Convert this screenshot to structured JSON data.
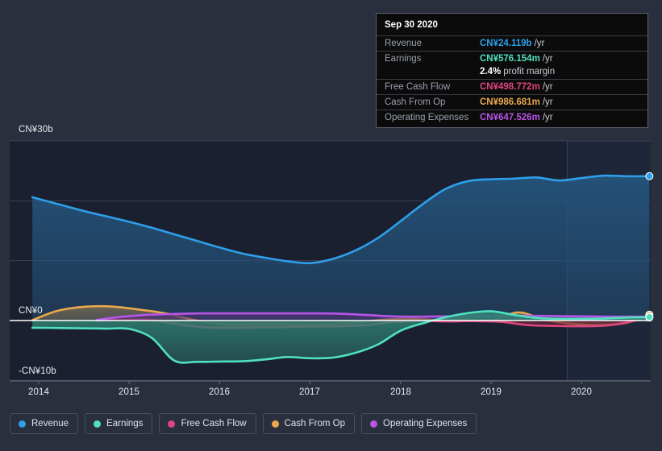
{
  "chart_data": {
    "type": "area",
    "title": "",
    "xlabel": "",
    "ylabel": "",
    "currency": "CN¥",
    "grid": true,
    "legend_position": "bottom",
    "xlim": [
      2013.57,
      2020.78
    ],
    "ylim": [
      -11.5,
      31.8
    ],
    "x_ticks": [
      "2014",
      "2015",
      "2016",
      "2017",
      "2018",
      "2019",
      "2020"
    ],
    "x_tick_values": [
      2014,
      2015,
      2016,
      2017,
      2018,
      2019,
      2020
    ],
    "y_ticks": [
      "CN¥30b",
      "CN¥0",
      "-CN¥10b"
    ],
    "y_tick_values": [
      30,
      0,
      -10
    ],
    "y_gridline_values": [
      30,
      20,
      10,
      0,
      -10
    ],
    "zero_line_value": 0,
    "forecast_start": 2019.84,
    "units": "billions CN¥ per year",
    "series": [
      {
        "name": "Revenue",
        "color": "#2e9fea",
        "fill": "#24547c",
        "x": [
          2013.93,
          2014.25,
          2014.5,
          2014.75,
          2015.0,
          2015.25,
          2015.5,
          2015.75,
          2016.0,
          2016.25,
          2016.5,
          2016.75,
          2017.0,
          2017.25,
          2017.5,
          2017.75,
          2018.0,
          2018.25,
          2018.5,
          2018.75,
          2019.0,
          2019.25,
          2019.5,
          2019.75,
          2020.0,
          2020.25,
          2020.5,
          2020.75
        ],
        "values": [
          20.6,
          19.3,
          18.3,
          17.4,
          16.5,
          15.5,
          14.4,
          13.3,
          12.2,
          11.2,
          10.5,
          9.9,
          9.6,
          10.3,
          11.7,
          13.8,
          16.6,
          19.5,
          22.0,
          23.3,
          23.6,
          23.7,
          23.9,
          23.4,
          23.8,
          24.2,
          24.1,
          24.119
        ]
      },
      {
        "name": "Earnings",
        "color": "#4fe0c0",
        "fill": "#2f7f71",
        "x": [
          2013.93,
          2014.25,
          2014.5,
          2014.75,
          2015.0,
          2015.25,
          2015.5,
          2015.75,
          2016.0,
          2016.25,
          2016.5,
          2016.75,
          2017.0,
          2017.25,
          2017.5,
          2017.75,
          2018.0,
          2018.25,
          2018.5,
          2018.75,
          2019.0,
          2019.25,
          2019.5,
          2019.75,
          2020.0,
          2020.25,
          2020.5,
          2020.75
        ],
        "values": [
          -1.2,
          -1.25,
          -1.3,
          -1.35,
          -1.4,
          -2.9,
          -6.7,
          -6.9,
          -6.85,
          -6.8,
          -6.5,
          -6.1,
          -6.3,
          -6.2,
          -5.4,
          -4.0,
          -1.7,
          -0.45,
          0.55,
          1.25,
          1.55,
          0.95,
          0.45,
          0.3,
          0.3,
          0.35,
          0.5,
          0.576
        ]
      },
      {
        "name": "Free Cash Flow",
        "color": "#e0447e",
        "fill": "#6b2438",
        "x": [
          2014.64,
          2014.9,
          2015.2,
          2015.5,
          2015.8,
          2016.1,
          2016.4,
          2016.7,
          2017.0,
          2017.3,
          2017.6,
          2017.9,
          2018.2,
          2018.5,
          2018.8,
          2019.1,
          2019.4,
          2019.7,
          2020.0,
          2020.3,
          2020.55,
          2020.75
        ],
        "values": [
          -0.1,
          0.1,
          0.15,
          -0.5,
          -1.1,
          -1.2,
          -1.15,
          -1.1,
          -1.0,
          -0.95,
          -0.8,
          -0.3,
          -0.05,
          -0.15,
          -0.1,
          -0.2,
          -0.75,
          -0.9,
          -0.95,
          -0.8,
          -0.15,
          0.4988
        ]
      },
      {
        "name": "Cash From Op",
        "color": "#eaa84e",
        "fill": "#6e6550",
        "x": [
          2013.93,
          2014.2,
          2014.5,
          2014.8,
          2015.1,
          2015.4,
          2015.7,
          2016.0,
          2016.3,
          2016.6,
          2016.9,
          2017.2,
          2017.5,
          2017.8,
          2018.1,
          2018.4,
          2018.7,
          2019.0,
          2019.3,
          2019.6,
          2019.9,
          2020.2,
          2020.5,
          2020.75
        ],
        "values": [
          0.05,
          1.6,
          2.3,
          2.35,
          1.85,
          1.2,
          0.15,
          -0.6,
          -0.7,
          -0.6,
          -0.75,
          -0.6,
          -0.35,
          0.15,
          0.3,
          0.1,
          0.25,
          0.0,
          1.35,
          0.1,
          -0.55,
          -0.75,
          -0.35,
          0.9867
        ]
      },
      {
        "name": "Operating Expenses",
        "color": "#b855e8",
        "fill": "#4b3272",
        "x": [
          2014.64,
          2014.9,
          2015.2,
          2015.5,
          2015.8,
          2016.1,
          2016.4,
          2016.7,
          2017.0,
          2017.3,
          2017.6,
          2017.9,
          2018.2,
          2018.5,
          2018.8,
          2019.1,
          2019.4,
          2019.7,
          2020.0,
          2020.3,
          2020.55,
          2020.75
        ],
        "values": [
          0.1,
          0.6,
          0.95,
          1.1,
          1.2,
          1.2,
          1.2,
          1.2,
          1.2,
          1.15,
          0.95,
          0.7,
          0.65,
          0.7,
          0.75,
          0.8,
          0.8,
          0.75,
          0.7,
          0.65,
          0.65,
          0.6475
        ]
      }
    ]
  },
  "tooltip": {
    "date": "Sep 30 2020",
    "rows": [
      {
        "key": "Revenue",
        "value": "CN¥24.119b",
        "suffix": "/yr",
        "color": "#2e9fea"
      },
      {
        "key": "Earnings",
        "value": "CN¥576.154m",
        "suffix": "/yr",
        "color": "#4fe0c0"
      },
      {
        "key": "",
        "value": "2.4%",
        "suffix": "profit margin",
        "color": "#ffffff"
      },
      {
        "key": "Free Cash Flow",
        "value": "CN¥498.772m",
        "suffix": "/yr",
        "color": "#e0447e"
      },
      {
        "key": "Cash From Op",
        "value": "CN¥986.681m",
        "suffix": "/yr",
        "color": "#eaa84e"
      },
      {
        "key": "Operating Expenses",
        "value": "CN¥647.526m",
        "suffix": "/yr",
        "color": "#b855e8"
      }
    ]
  },
  "legend": {
    "items": [
      {
        "label": "Revenue",
        "color": "#2e9fea"
      },
      {
        "label": "Earnings",
        "color": "#4fe0c0"
      },
      {
        "label": "Free Cash Flow",
        "color": "#e0447e"
      },
      {
        "label": "Cash From Op",
        "color": "#eaa84e"
      },
      {
        "label": "Operating Expenses",
        "color": "#b855e8"
      }
    ]
  },
  "colors": {
    "background": "#2a2f3d",
    "plot_background": "#1b2030",
    "forecast_background": "#1e2639",
    "gridline": "#3b4152",
    "zero_line": "#ffffff",
    "axis_text": "#e8eaed"
  }
}
